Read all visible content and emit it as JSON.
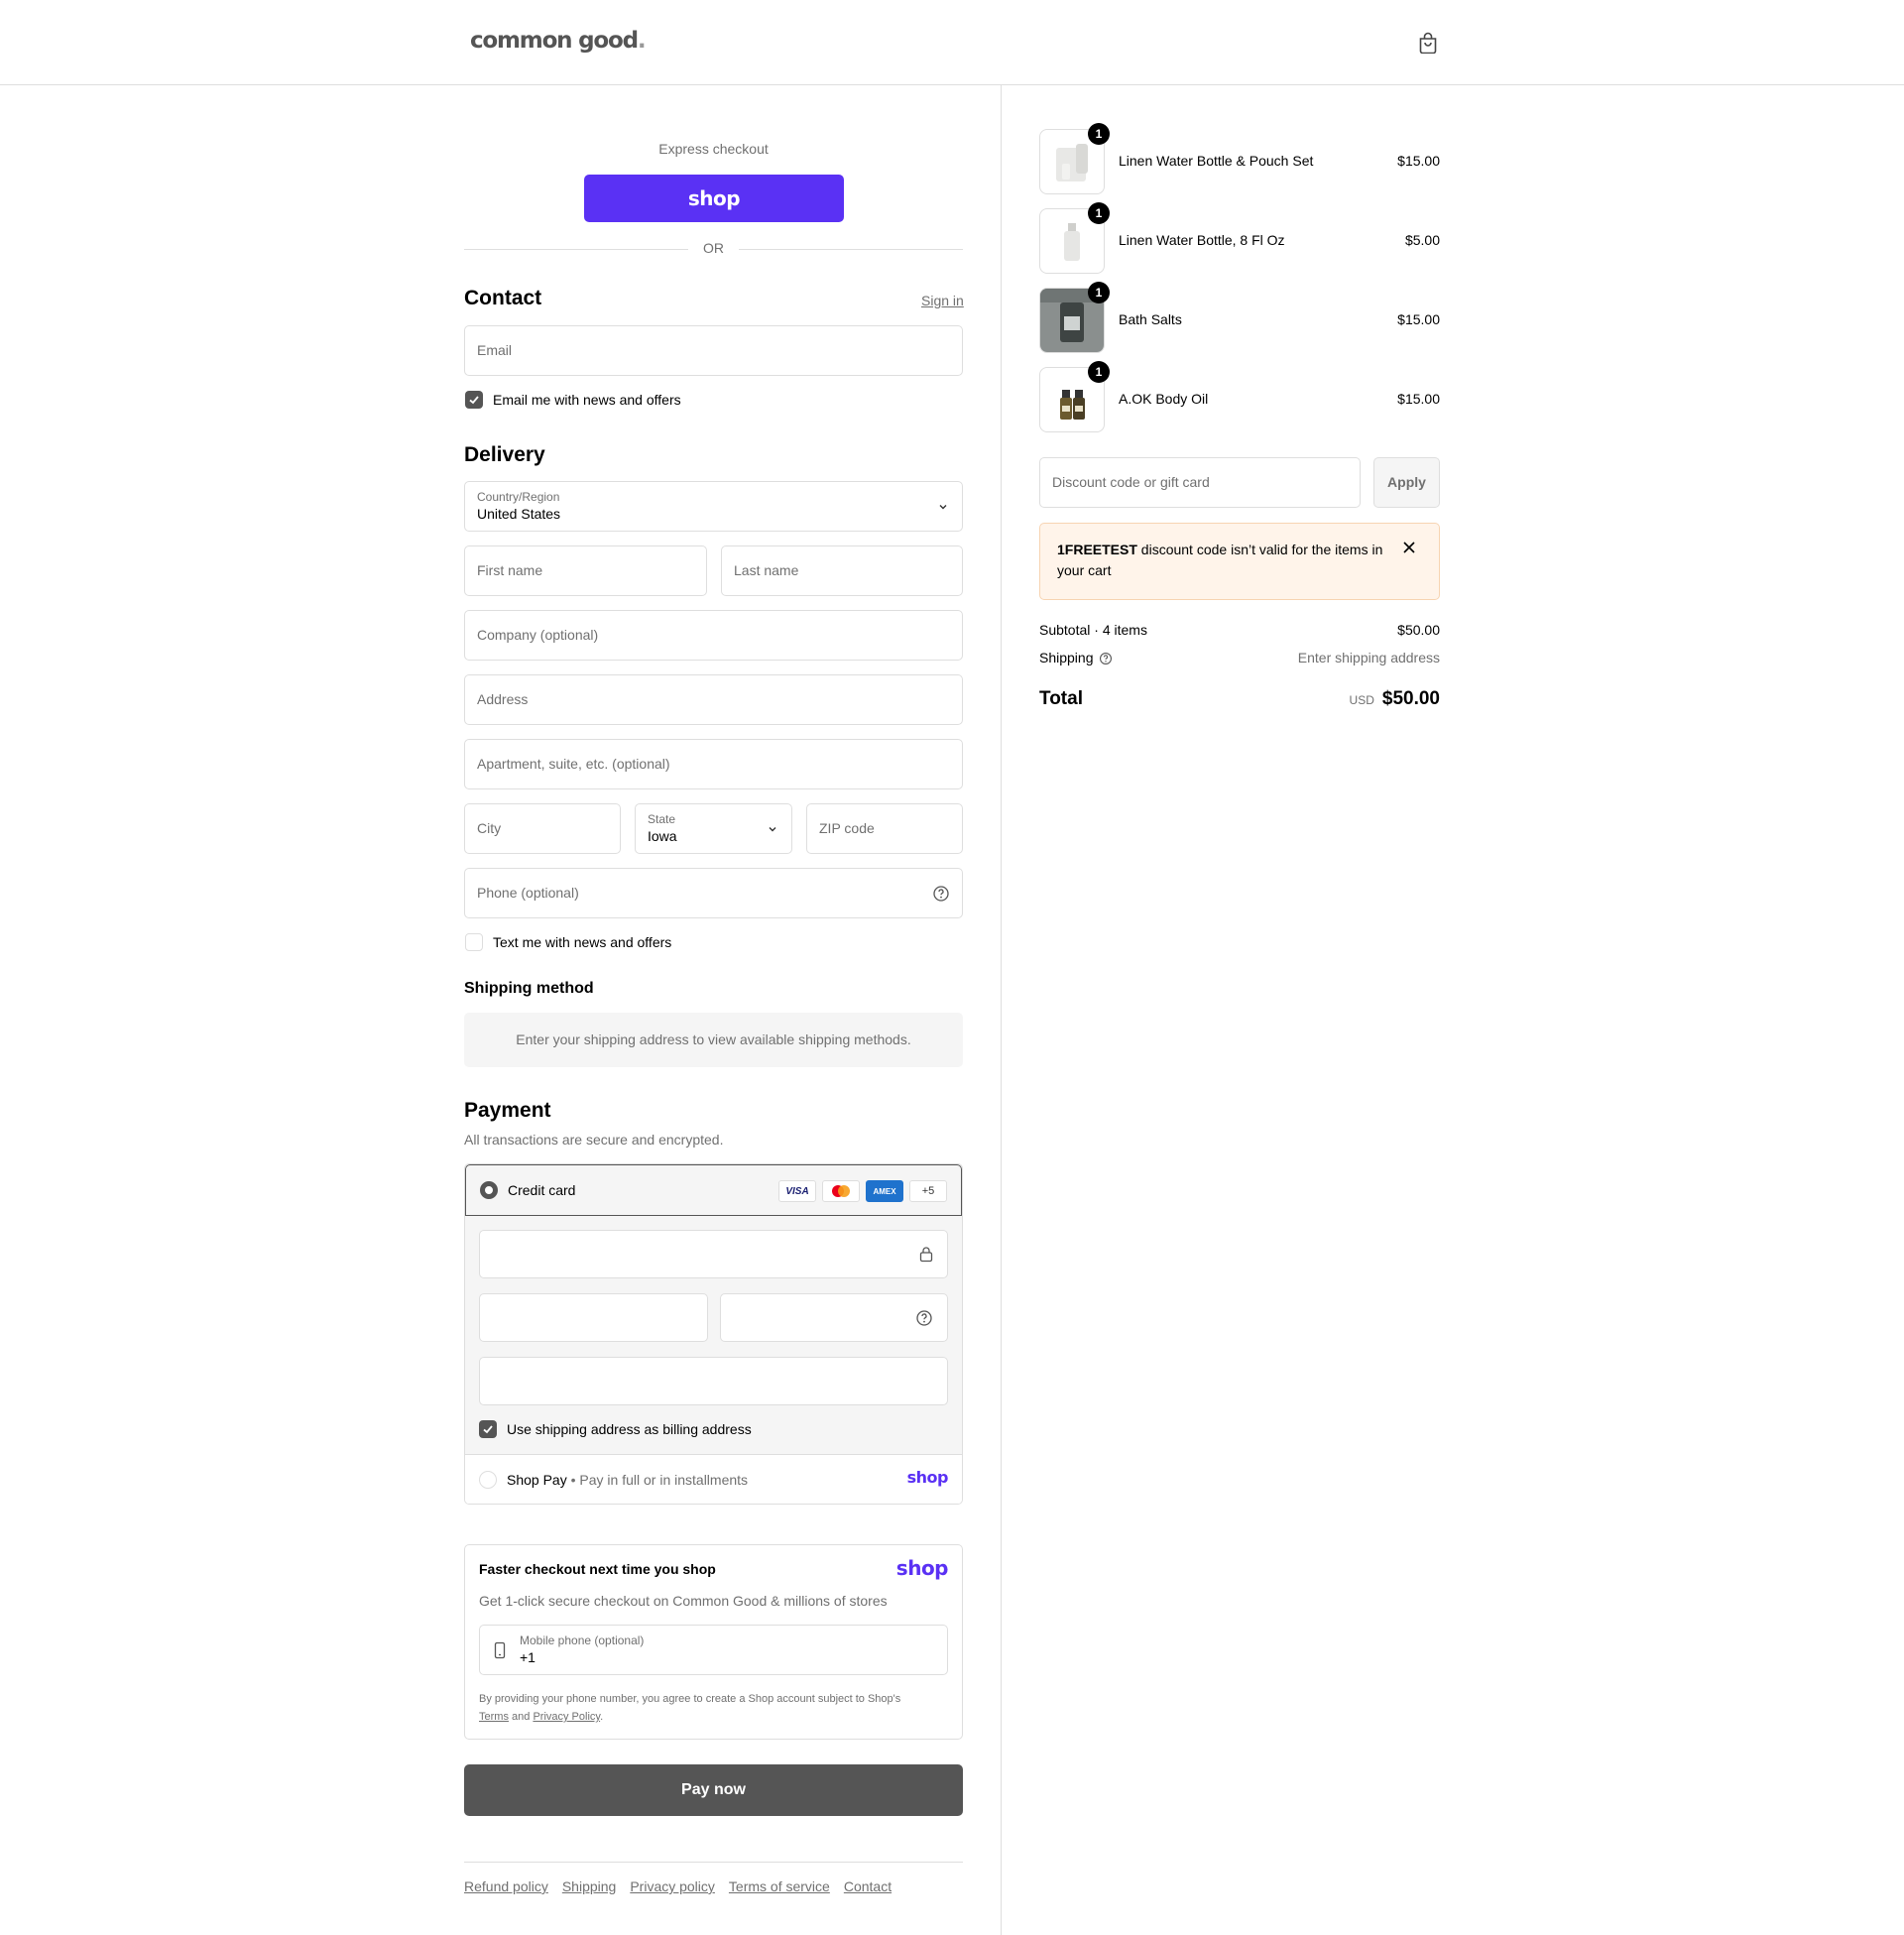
{
  "header": {
    "logo": "common good",
    "logo_dot": ".",
    "cart_icon": "shopping-bag-icon"
  },
  "express": {
    "label": "Express checkout",
    "shop_button": "shop",
    "or": "OR"
  },
  "contact": {
    "heading": "Contact",
    "sign_in": "Sign in",
    "email_placeholder": "Email",
    "email_opt_in_label": "Email me with news and offers",
    "email_opt_in_checked": true
  },
  "delivery": {
    "heading": "Delivery",
    "country_label": "Country/Region",
    "country_value": "United States",
    "first_name": "First name",
    "last_name": "Last name",
    "company": "Company (optional)",
    "address": "Address",
    "apartment": "Apartment, suite, etc. (optional)",
    "city": "City",
    "state_label": "State",
    "state_value": "Iowa",
    "zip": "ZIP code",
    "phone": "Phone (optional)",
    "sms_opt_in_label": "Text me with news and offers",
    "sms_opt_in_checked": false
  },
  "shipping_method": {
    "heading": "Shipping method",
    "note": "Enter your shipping address to view available shipping methods."
  },
  "payment": {
    "heading": "Payment",
    "subtitle": "All transactions are secure and encrypted.",
    "credit_card_label": "Credit card",
    "card_brands": [
      "VISA",
      "mastercard",
      "AMEX",
      "+5"
    ],
    "billing_same_label": "Use shipping address as billing address",
    "billing_same_checked": true,
    "shop_pay_label": "Shop Pay",
    "shop_pay_sep": "•",
    "shop_pay_desc": "Pay in full or in installments",
    "shop_pay_logo": "shop"
  },
  "faster": {
    "title": "Faster checkout next time you shop",
    "logo": "shop",
    "desc": "Get 1-click secure checkout on Common Good & millions of stores",
    "mobile_label": "Mobile phone (optional)",
    "mobile_value": "+1",
    "legal_prefix": "By providing your phone number, you agree to create a Shop account subject to Shop's",
    "terms": "Terms",
    "and": "and",
    "privacy": "Privacy Policy",
    "period": "."
  },
  "pay_now": "Pay now",
  "footer_links": [
    "Refund policy",
    "Shipping",
    "Privacy policy",
    "Terms of service",
    "Contact"
  ],
  "order": {
    "items": [
      {
        "name": "Linen Water Bottle & Pouch Set",
        "price": "$15.00",
        "qty": "1"
      },
      {
        "name": "Linen Water Bottle, 8 Fl Oz",
        "price": "$5.00",
        "qty": "1"
      },
      {
        "name": "Bath Salts",
        "price": "$15.00",
        "qty": "1"
      },
      {
        "name": "A.OK Body Oil",
        "price": "$15.00",
        "qty": "1"
      }
    ],
    "discount_placeholder": "Discount code or gift card",
    "apply": "Apply",
    "alert_code": "1FREETEST",
    "alert_text": " discount code isn’t valid for the items in your cart",
    "subtotal_label": "Subtotal · 4 items",
    "subtotal_value": "$50.00",
    "shipping_label": "Shipping",
    "shipping_value": "Enter shipping address",
    "total_label": "Total",
    "currency": "USD",
    "total_value": "$50.00"
  },
  "colors": {
    "shop_purple": "#5a31f4",
    "button_gray": "#555555",
    "alert_bg": "#fff4ea"
  }
}
